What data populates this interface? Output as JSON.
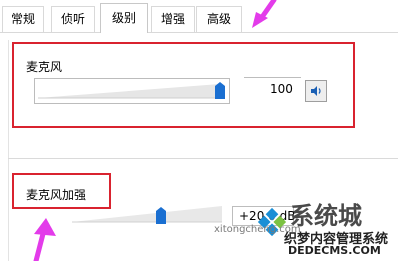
{
  "tabs": [
    {
      "label": "常规"
    },
    {
      "label": "侦听"
    },
    {
      "label": "级别"
    },
    {
      "label": "增强"
    },
    {
      "label": "高级"
    }
  ],
  "active_tab_index": 2,
  "microphone": {
    "label": "麦克风",
    "level": 100,
    "level_display": "100",
    "level_fraction": 1.0
  },
  "boost": {
    "label": "麦克风加强",
    "value_display": "+20.0 dB",
    "level_fraction": 0.5
  },
  "watermark": {
    "brand": "系统城",
    "site": "xitongcheng.com",
    "overlay_title": "织梦内容管理系统",
    "overlay_site": "DEDECMS.COM"
  },
  "colors": {
    "highlight_box": "#d9232f",
    "annotation_arrow": "#e33bea",
    "thumb": "#1a6fd1"
  }
}
